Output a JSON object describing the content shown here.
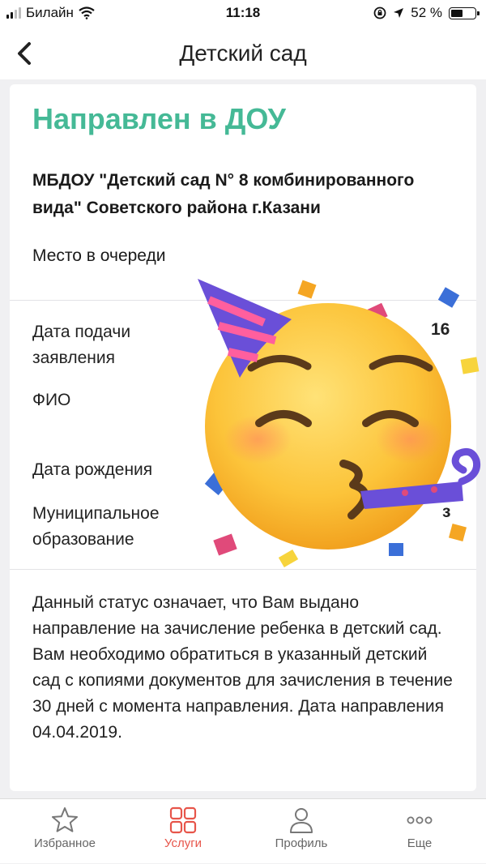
{
  "status_bar": {
    "carrier": "Билайн",
    "time": "11:18",
    "battery_percent": "52 %",
    "battery_level": 0.52,
    "icons": [
      "signal-icon",
      "wifi-icon",
      "rotation-lock-icon",
      "location-icon",
      "battery-icon"
    ]
  },
  "nav": {
    "title": "Детский сад",
    "back_icon": "chevron-left-icon"
  },
  "card": {
    "status_title": "Направлен в ДОУ",
    "status_color": "#45b996",
    "org_name": "МБДОУ \"Детский сад N° 8 комбинированного вида\" Советского района г.Казани",
    "queue_label": "Место в очереди",
    "fields": [
      {
        "label": "Дата подачи заявления",
        "value_fragment": "16"
      },
      {
        "label": "ФИО",
        "value_fragment": ""
      },
      {
        "label": "Дата рождения",
        "value_fragment": ""
      },
      {
        "label": "Муниципальное образование",
        "value_fragment": "з"
      }
    ],
    "description": "Данный статус означает, что Вам выдано направление на зачисление ребенка в детский сад. Вам необходимо обратиться в указанный детский сад с копиями документов для зачисления в течение 30 дней с момента направления. Дата направления 04.04.2019."
  },
  "overlay": {
    "icon": "partying-face-emoji"
  },
  "tabbar": {
    "active_color": "#e7554a",
    "tabs": [
      {
        "label": "Избранное",
        "icon": "star-icon",
        "active": false
      },
      {
        "label": "Услуги",
        "icon": "grid-icon",
        "active": true
      },
      {
        "label": "Профиль",
        "icon": "person-icon",
        "active": false
      },
      {
        "label": "Еще",
        "icon": "more-icon",
        "active": false
      }
    ]
  }
}
